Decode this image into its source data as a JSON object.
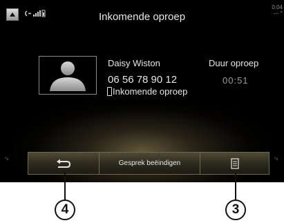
{
  "status_bar": {
    "title": "Inkomende oproep",
    "clock_line1": "0:04",
    "clock_line2": "--- °"
  },
  "call": {
    "name": "Daisy Wiston",
    "number": "06 56 78 90 12",
    "status": "Inkomende oproep",
    "duration_label": "Duur oproep",
    "duration_value": "00:51"
  },
  "bottom_bar": {
    "end_call_label": "Gesprek beëindigen",
    "unit_left": "°c",
    "unit_right": "°c"
  },
  "callouts": {
    "back": "4",
    "menu": "3"
  },
  "icons": {
    "home": "triangle-up-icon",
    "signal": "signal-strength-icon",
    "avatar": "person-silhouette-icon",
    "phone": "phone-handset-icon",
    "back": "return-arrow-icon",
    "menu": "list-menu-icon"
  }
}
